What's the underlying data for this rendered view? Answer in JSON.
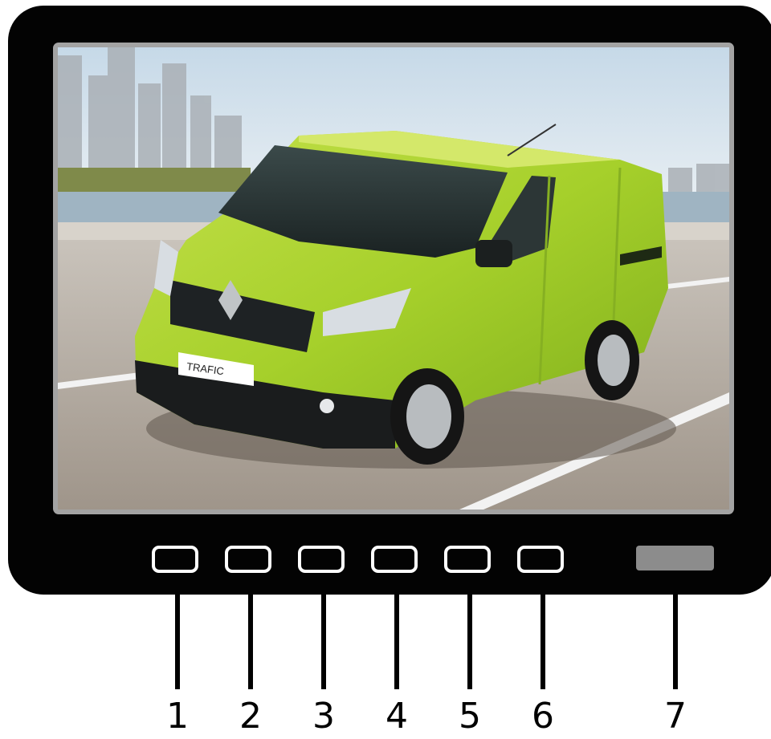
{
  "image": {
    "subject": "monitor-screen-photo",
    "badge_text": "TRAFIC"
  },
  "callouts": [
    {
      "number": "1",
      "target": "button"
    },
    {
      "number": "2",
      "target": "button"
    },
    {
      "number": "3",
      "target": "button"
    },
    {
      "number": "4",
      "target": "button"
    },
    {
      "number": "5",
      "target": "button"
    },
    {
      "number": "6",
      "target": "button"
    },
    {
      "number": "7",
      "target": "indicator"
    }
  ],
  "colors": {
    "bezel": "#030303",
    "button_outline": "#ffffff",
    "indicator": "#8c8c8c",
    "van_body": "#a6d02b"
  }
}
